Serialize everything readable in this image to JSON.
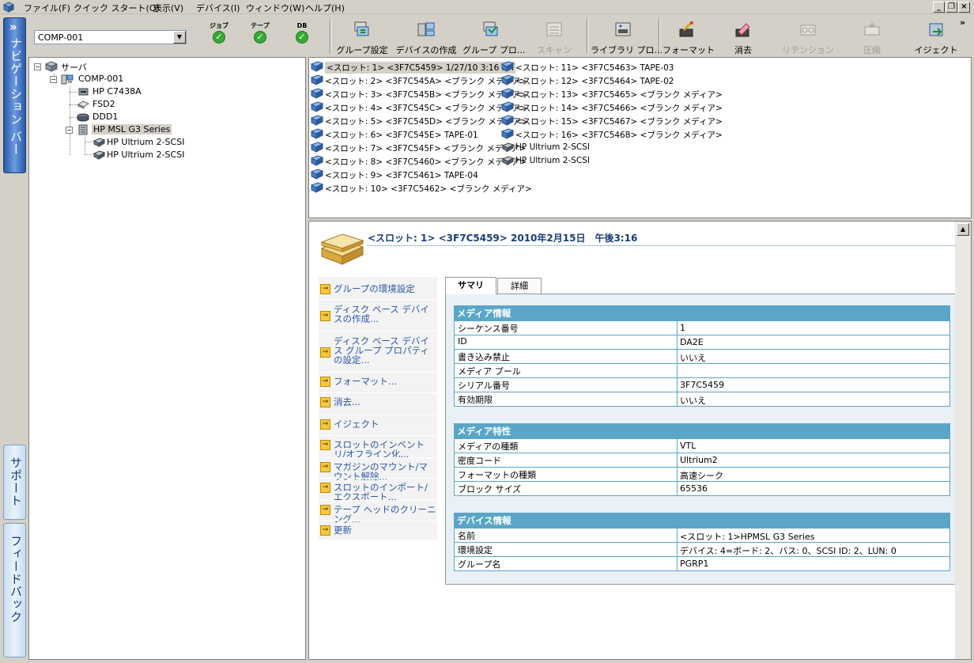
{
  "menu": {
    "items": [
      "ファイル(F)",
      "クイック スタート(Q)",
      "表示(V)",
      "デバイス(I)",
      "ウィンドウ(W)",
      "ヘルプ(H)"
    ]
  },
  "window_controls": {
    "minimize": "_",
    "restore": "❐",
    "close": "×"
  },
  "toolbar": {
    "device_select_value": "COMP-001",
    "status": [
      {
        "label": "ジョブ"
      },
      {
        "label": "テープ"
      },
      {
        "label": "DB"
      }
    ],
    "buttons": {
      "group_settings": "グループ設定",
      "create_device": "デバイスの作成",
      "group_props": "グループ プロ...",
      "scan": "スキャン",
      "library_props": "ライブラリ プロ...",
      "format": "フォーマット",
      "erase": "消去",
      "retention": "リテンション",
      "compress": "圧縮",
      "eject": "イジェクト"
    },
    "overflow": "»"
  },
  "navbar": {
    "chevron": "»",
    "nav_label": "ナビゲーション バー",
    "support_label": "サポート",
    "feedback_label": "フィードバック"
  },
  "tree": {
    "server": "サーバ",
    "comp": "COMP-001",
    "children": [
      "HP C7438A",
      "FSD2",
      "DDD1",
      "HP MSL G3 Series"
    ],
    "library_children": [
      "HP Ultrium 2-SCSI",
      "HP Ultrium 2-SCSI"
    ]
  },
  "slots": {
    "col1": [
      "<スロット: 1> <3F7C5459> 1/27/10 3:16 PM",
      "<スロット: 2> <3F7C545A> <ブランク メディア>",
      "<スロット: 3> <3F7C545B> <ブランク メディア>",
      "<スロット: 4> <3F7C545C> <ブランク メディア>",
      "<スロット: 5> <3F7C545D> <ブランク メディア>",
      "<スロット: 6> <3F7C545E> TAPE-01",
      "<スロット: 7> <3F7C545F> <ブランク メディア>",
      "<スロット: 8> <3F7C5460> <ブランク メディア>",
      "<スロット: 9> <3F7C5461> TAPE-04",
      "<スロット: 10> <3F7C5462> <ブランク メディア>"
    ],
    "col2": [
      "<スロット: 11> <3F7C5463> TAPE-03",
      "<スロット: 12> <3F7C5464> TAPE-02",
      "<スロット: 13> <3F7C5465> <ブランク メディア>",
      "<スロット: 14> <3F7C5466> <ブランク メディア>",
      "<スロット: 15> <3F7C5467> <ブランク メディア>",
      "<スロット: 16> <3F7C5468> <ブランク メディア>",
      "HP Ultrium 2-SCSI",
      "HP Ultrium 2-SCSI"
    ]
  },
  "detail": {
    "title": "<スロット: 1> <3F7C5459> 2010年2月15日　午後3:16",
    "tasks": [
      "グループの環境設定",
      "ディスク ベース デバイスの作成...",
      "ディスク ベース デバイス グループ プロパティの設定...",
      "フォーマット...",
      "消去...",
      "イジェクト",
      "スロットのインベントリ/オフライン化...",
      "マガジンのマウント/マウント解除...",
      "スロットのインポート/エクスポート...",
      "テープ ヘッドのクリーニング...",
      "更新"
    ],
    "tabs": [
      "サマリ",
      "詳細"
    ],
    "sections": [
      {
        "title": "メディア情報",
        "rows": [
          [
            "シーケンス番号",
            "1"
          ],
          [
            "ID",
            "DA2E"
          ],
          [
            "書き込み禁止",
            "いいえ"
          ],
          [
            "メディア プール",
            ""
          ],
          [
            "シリアル番号",
            "3F7C5459"
          ],
          [
            "有効期限",
            "いいえ"
          ]
        ]
      },
      {
        "title": "メディア特性",
        "rows": [
          [
            "メディアの種類",
            "VTL"
          ],
          [
            "密度コード",
            "Ultrium2"
          ],
          [
            "フォーマットの種類",
            "高速シーク"
          ],
          [
            "ブロック サイズ",
            "65536"
          ]
        ]
      },
      {
        "title": "デバイス情報",
        "rows": [
          [
            "名前",
            "<スロット: 1>HPMSL G3 Series"
          ],
          [
            "環境設定",
            "デバイス: 4=ボード: 2、バス: 0、SCSI ID: 2、LUN: 0"
          ],
          [
            "グループ名",
            "PGRP1"
          ]
        ]
      }
    ],
    "scroll_up": "▲"
  }
}
